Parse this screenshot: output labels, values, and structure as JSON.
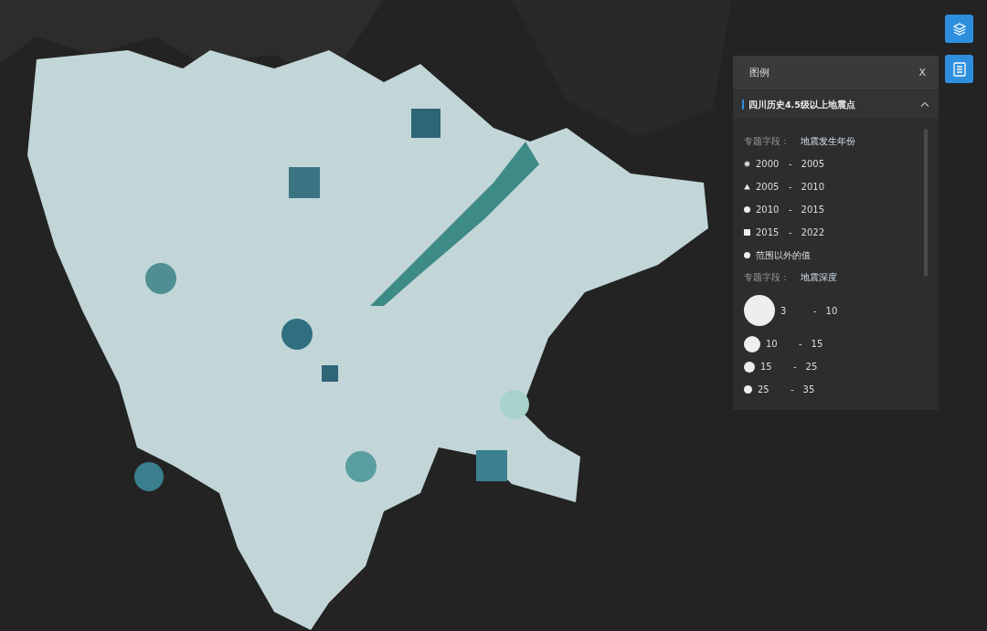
{
  "toolbar": [
    {
      "kind": "layers"
    },
    {
      "kind": "list"
    }
  ],
  "legend": {
    "title": "图例",
    "close": "X",
    "layer": {
      "name": "四川历史4.5级以上地震点",
      "expanded": true,
      "groups": [
        {
          "label": "专题字段：",
          "field": "地震发生年份",
          "items": [
            {
              "kind": "dot",
              "from": "2000",
              "sep": "-",
              "to": "2005"
            },
            {
              "kind": "triangle",
              "from": "2005",
              "sep": "-",
              "to": "2010"
            },
            {
              "kind": "circle",
              "from": "2010",
              "sep": "-",
              "to": "2015"
            },
            {
              "kind": "square",
              "from": "2015",
              "sep": "-",
              "to": "2022"
            },
            {
              "kind": "circle",
              "text": "范围以外的值"
            }
          ]
        },
        {
          "label": "专题字段：",
          "field": "地震深度",
          "items": [
            {
              "kind": "circle-xl",
              "from": "3",
              "sep": "-",
              "to": "10"
            },
            {
              "kind": "circle-l",
              "from": "10",
              "sep": "-",
              "to": "15"
            },
            {
              "kind": "circle-m",
              "from": "15",
              "sep": "-",
              "to": "25"
            },
            {
              "kind": "circle-s",
              "from": "25",
              "sep": "-",
              "to": "35"
            }
          ]
        }
      ]
    }
  }
}
